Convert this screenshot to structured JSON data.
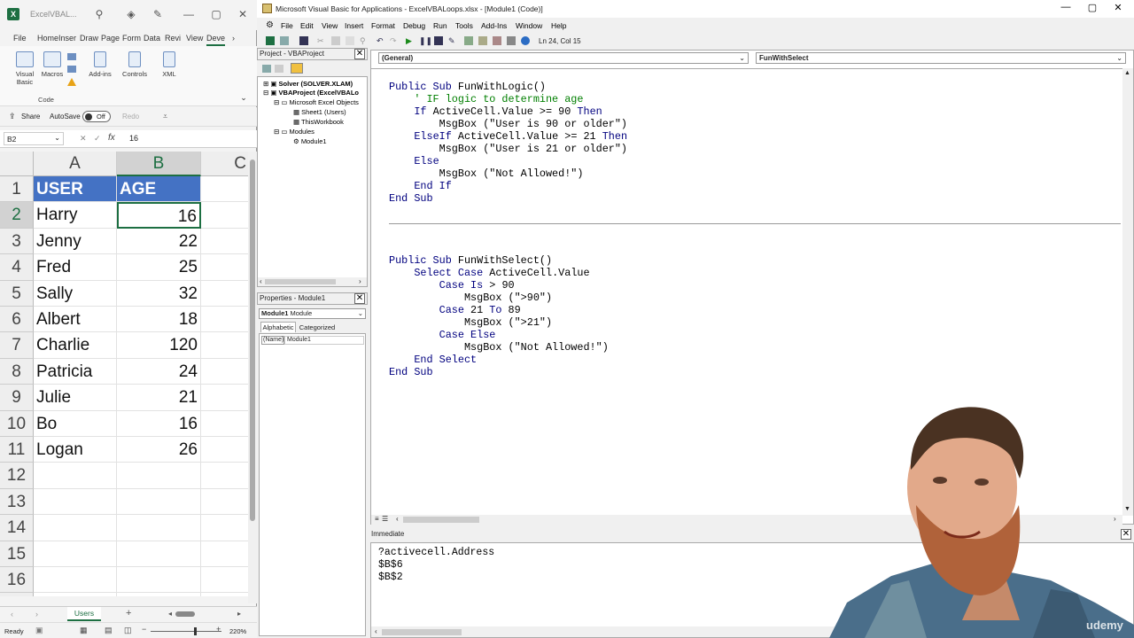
{
  "excel": {
    "file_name": "ExcelVBAL...",
    "tabs": [
      "File",
      "Home",
      "Inser",
      "Draw",
      "Page",
      "Form",
      "Data",
      "Revi",
      "View",
      "Deve"
    ],
    "ribbon": {
      "visual_basic": "Visual Basic",
      "macros": "Macros",
      "addins": "Add-ins",
      "controls": "Controls",
      "xml": "XML",
      "group_code": "Code"
    },
    "qa": {
      "share": "Share",
      "autosave": "AutoSave",
      "autosave_state": "Off",
      "redo": "Redo"
    },
    "name_box": "B2",
    "fx": "fx",
    "formula_value": "16",
    "columns": [
      "A",
      "B",
      "C"
    ],
    "rows": [
      {
        "num": "1",
        "a": "USER",
        "b": "AGE"
      },
      {
        "num": "2",
        "a": "Harry",
        "b": "16"
      },
      {
        "num": "3",
        "a": "Jenny",
        "b": "22"
      },
      {
        "num": "4",
        "a": "Fred",
        "b": "25"
      },
      {
        "num": "5",
        "a": "Sally",
        "b": "32"
      },
      {
        "num": "6",
        "a": "Albert",
        "b": "18"
      },
      {
        "num": "7",
        "a": "Charlie",
        "b": "120"
      },
      {
        "num": "8",
        "a": "Patricia",
        "b": "24"
      },
      {
        "num": "9",
        "a": "Julie",
        "b": "21"
      },
      {
        "num": "10",
        "a": "Bo",
        "b": "16"
      },
      {
        "num": "11",
        "a": "Logan",
        "b": "26"
      },
      {
        "num": "12",
        "a": "",
        "b": ""
      },
      {
        "num": "13",
        "a": "",
        "b": ""
      },
      {
        "num": "14",
        "a": "",
        "b": ""
      },
      {
        "num": "15",
        "a": "",
        "b": ""
      },
      {
        "num": "16",
        "a": "",
        "b": ""
      },
      {
        "num": "17",
        "a": "",
        "b": ""
      }
    ],
    "sheet_tab": "Users",
    "status_ready": "Ready",
    "zoom": "220%",
    "header_color": "#4472c4"
  },
  "vbe": {
    "title": "Microsoft Visual Basic for Applications - ExcelVBALoops.xlsx - [Module1 (Code)]",
    "menu": [
      "File",
      "Edit",
      "View",
      "Insert",
      "Format",
      "Debug",
      "Run",
      "Tools",
      "Add-Ins",
      "Window",
      "Help"
    ],
    "cursor_pos": "Ln 24, Col 15",
    "project": {
      "title": "Project - VBAProject",
      "items": [
        "Solver (SOLVER.XLAM)",
        "VBAProject (ExcelVBALo",
        "Microsoft Excel Objects",
        "Sheet1 (Users)",
        "ThisWorkbook",
        "Modules",
        "Module1"
      ]
    },
    "properties": {
      "title": "Properties - Module1",
      "object": "Module1",
      "object_type": "Module",
      "tab_alpha": "Alphabetic",
      "tab_cat": "Categorized",
      "prop_name": "(Name)",
      "prop_value": "Module1"
    },
    "code": {
      "object_dropdown": "(General)",
      "proc_dropdown": "FunWithSelect",
      "block1": [
        "Public Sub FunWithLogic()",
        "    ' IF logic to determine age",
        "    If ActiveCell.Value >= 90 Then",
        "        MsgBox (\"User is 90 or older\")",
        "    ElseIf ActiveCell.Value >= 21 Then",
        "        MsgBox (\"User is 21 or older\")",
        "    Else",
        "        MsgBox (\"Not Allowed!\")",
        "    End If",
        "End Sub"
      ],
      "block2": [
        "Public Sub FunWithSelect()",
        "    Select Case ActiveCell.Value",
        "        Case Is > 90",
        "            MsgBox (\">90\")",
        "        Case 21 To 89",
        "            MsgBox (\">21\")",
        "        Case Else",
        "            MsgBox (\"Not Allowed!\")",
        "    End Select",
        "End Sub"
      ]
    },
    "immediate": {
      "title": "Immediate",
      "lines": [
        "?activecell.Address",
        "$B$6",
        "$B$2"
      ]
    },
    "watermark": "udemy"
  }
}
